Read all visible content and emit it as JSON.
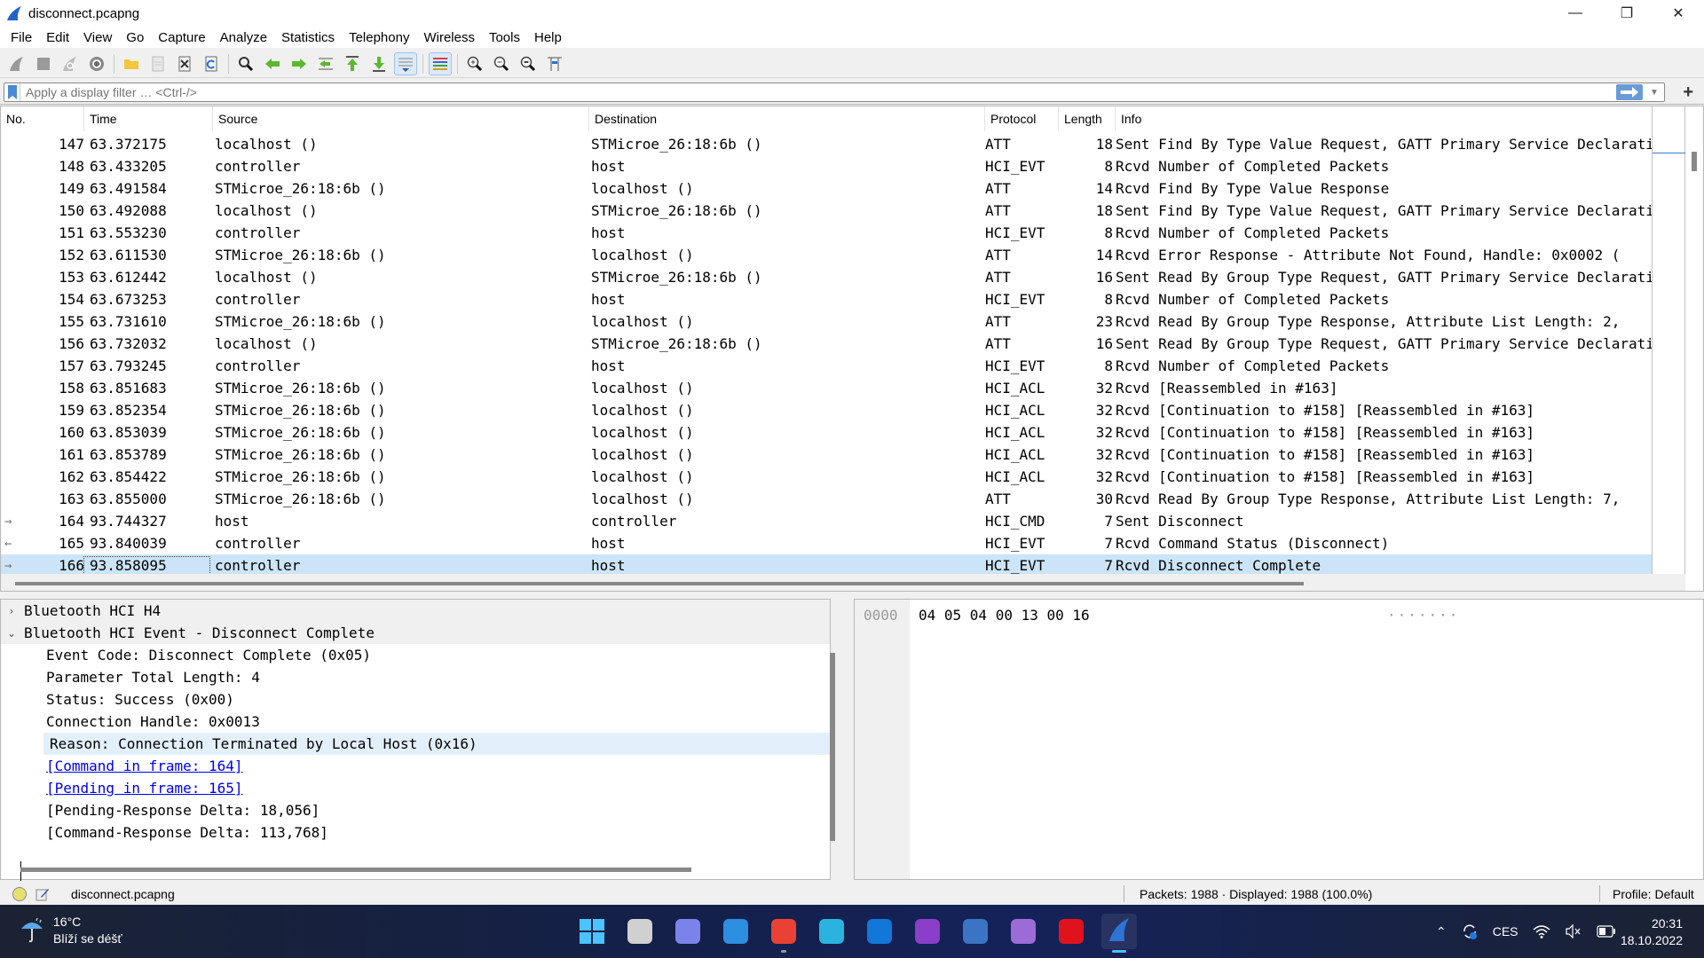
{
  "window": {
    "title": "disconnect.pcapng",
    "controls": [
      "minimize",
      "maximize",
      "close"
    ]
  },
  "menu": [
    "File",
    "Edit",
    "View",
    "Go",
    "Capture",
    "Analyze",
    "Statistics",
    "Telephony",
    "Wireless",
    "Tools",
    "Help"
  ],
  "toolbar": {
    "buttons": [
      {
        "name": "start-capture-icon",
        "active": false
      },
      {
        "name": "stop-capture-icon",
        "active": false
      },
      {
        "name": "restart-capture-icon",
        "active": false
      },
      {
        "name": "capture-options-icon",
        "active": false
      },
      {
        "name": "open-file-icon",
        "active": false
      },
      {
        "name": "save-file-icon",
        "active": false
      },
      {
        "name": "close-file-icon",
        "active": false
      },
      {
        "name": "reload-file-icon",
        "active": false
      },
      {
        "name": "find-packet-icon",
        "active": false
      },
      {
        "name": "go-back-icon",
        "active": false
      },
      {
        "name": "go-forward-icon",
        "active": false
      },
      {
        "name": "go-to-packet-icon",
        "active": false
      },
      {
        "name": "go-first-packet-icon",
        "active": false
      },
      {
        "name": "go-last-packet-icon",
        "active": false
      },
      {
        "name": "auto-scroll-icon",
        "active": true
      },
      {
        "name": "colorize-icon",
        "active": true
      },
      {
        "name": "zoom-in-icon",
        "active": false
      },
      {
        "name": "zoom-out-icon",
        "active": false
      },
      {
        "name": "normal-size-icon",
        "active": false
      },
      {
        "name": "resize-columns-icon",
        "active": false
      }
    ]
  },
  "filter": {
    "placeholder": "Apply a display filter … <Ctrl-/>",
    "value": ""
  },
  "packet_list": {
    "columns": [
      "No.",
      "Time",
      "Source",
      "Destination",
      "Protocol",
      "Length",
      "Info"
    ],
    "rows": [
      {
        "arrow": "",
        "no": "147",
        "time": "63.372175",
        "src": "localhost ()",
        "dst": "STMicroe_26:18:6b ()",
        "proto": "ATT",
        "len": "18",
        "info": "Sent Find By Type Value Request, GATT Primary Service Declaration"
      },
      {
        "arrow": "",
        "no": "148",
        "time": "63.433205",
        "src": "controller",
        "dst": "host",
        "proto": "HCI_EVT",
        "len": "8",
        "info": "Rcvd Number of Completed Packets"
      },
      {
        "arrow": "",
        "no": "149",
        "time": "63.491584",
        "src": "STMicroe_26:18:6b ()",
        "dst": "localhost ()",
        "proto": "ATT",
        "len": "14",
        "info": "Rcvd Find By Type Value Response"
      },
      {
        "arrow": "",
        "no": "150",
        "time": "63.492088",
        "src": "localhost ()",
        "dst": "STMicroe_26:18:6b ()",
        "proto": "ATT",
        "len": "18",
        "info": "Sent Find By Type Value Request, GATT Primary Service Declaration"
      },
      {
        "arrow": "",
        "no": "151",
        "time": "63.553230",
        "src": "controller",
        "dst": "host",
        "proto": "HCI_EVT",
        "len": "8",
        "info": "Rcvd Number of Completed Packets"
      },
      {
        "arrow": "",
        "no": "152",
        "time": "63.611530",
        "src": "STMicroe_26:18:6b ()",
        "dst": "localhost ()",
        "proto": "ATT",
        "len": "14",
        "info": "Rcvd Error Response - Attribute Not Found, Handle: 0x0002 ("
      },
      {
        "arrow": "",
        "no": "153",
        "time": "63.612442",
        "src": "localhost ()",
        "dst": "STMicroe_26:18:6b ()",
        "proto": "ATT",
        "len": "16",
        "info": "Sent Read By Group Type Request, GATT Primary Service Declaration"
      },
      {
        "arrow": "",
        "no": "154",
        "time": "63.673253",
        "src": "controller",
        "dst": "host",
        "proto": "HCI_EVT",
        "len": "8",
        "info": "Rcvd Number of Completed Packets"
      },
      {
        "arrow": "",
        "no": "155",
        "time": "63.731610",
        "src": "STMicroe_26:18:6b ()",
        "dst": "localhost ()",
        "proto": "ATT",
        "len": "23",
        "info": "Rcvd Read By Group Type Response, Attribute List Length: 2,"
      },
      {
        "arrow": "",
        "no": "156",
        "time": "63.732032",
        "src": "localhost ()",
        "dst": "STMicroe_26:18:6b ()",
        "proto": "ATT",
        "len": "16",
        "info": "Sent Read By Group Type Request, GATT Primary Service Declaration"
      },
      {
        "arrow": "",
        "no": "157",
        "time": "63.793245",
        "src": "controller",
        "dst": "host",
        "proto": "HCI_EVT",
        "len": "8",
        "info": "Rcvd Number of Completed Packets"
      },
      {
        "arrow": "",
        "no": "158",
        "time": "63.851683",
        "src": "STMicroe_26:18:6b ()",
        "dst": "localhost ()",
        "proto": "HCI_ACL",
        "len": "32",
        "info": "Rcvd  [Reassembled in #163]"
      },
      {
        "arrow": "",
        "no": "159",
        "time": "63.852354",
        "src": "STMicroe_26:18:6b ()",
        "dst": "localhost ()",
        "proto": "HCI_ACL",
        "len": "32",
        "info": "Rcvd  [Continuation to #158] [Reassembled in #163]"
      },
      {
        "arrow": "",
        "no": "160",
        "time": "63.853039",
        "src": "STMicroe_26:18:6b ()",
        "dst": "localhost ()",
        "proto": "HCI_ACL",
        "len": "32",
        "info": "Rcvd  [Continuation to #158] [Reassembled in #163]"
      },
      {
        "arrow": "",
        "no": "161",
        "time": "63.853789",
        "src": "STMicroe_26:18:6b ()",
        "dst": "localhost ()",
        "proto": "HCI_ACL",
        "len": "32",
        "info": "Rcvd  [Continuation to #158] [Reassembled in #163]"
      },
      {
        "arrow": "",
        "no": "162",
        "time": "63.854422",
        "src": "STMicroe_26:18:6b ()",
        "dst": "localhost ()",
        "proto": "HCI_ACL",
        "len": "32",
        "info": "Rcvd  [Continuation to #158] [Reassembled in #163]"
      },
      {
        "arrow": "",
        "no": "163",
        "time": "63.855000",
        "src": "STMicroe_26:18:6b ()",
        "dst": "localhost ()",
        "proto": "ATT",
        "len": "30",
        "info": "Rcvd Read By Group Type Response, Attribute List Length: 7,"
      },
      {
        "arrow": "→",
        "no": "164",
        "time": "93.744327",
        "src": "host",
        "dst": "controller",
        "proto": "HCI_CMD",
        "len": "7",
        "info": "Sent Disconnect"
      },
      {
        "arrow": "←",
        "no": "165",
        "time": "93.840039",
        "src": "controller",
        "dst": "host",
        "proto": "HCI_EVT",
        "len": "7",
        "info": "Rcvd Command Status (Disconnect)"
      },
      {
        "arrow": "→",
        "no": "166",
        "time": "93.858095",
        "src": "controller",
        "dst": "host",
        "proto": "HCI_EVT",
        "len": "7",
        "info": "Rcvd Disconnect Complete",
        "selected": true
      }
    ]
  },
  "details": {
    "tree": [
      {
        "label": "Bluetooth HCI H4",
        "expanded": false
      },
      {
        "label": "Bluetooth HCI Event - Disconnect Complete",
        "expanded": true,
        "children": [
          {
            "label": "Event Code: Disconnect Complete (0x05)"
          },
          {
            "label": "Parameter Total Length: 4"
          },
          {
            "label": "Status: Success (0x00)"
          },
          {
            "label": "Connection Handle: 0x0013"
          },
          {
            "label": "Reason: Connection Terminated by Local Host (0x16)",
            "highlighted": true
          },
          {
            "label": "[Command in frame: 164]",
            "link": true
          },
          {
            "label": "[Pending in frame: 165]",
            "link": true
          },
          {
            "label": "[Pending-Response Delta: 18,056]"
          },
          {
            "label": "[Command-Response Delta: 113,768]"
          }
        ]
      }
    ]
  },
  "bytes": {
    "offset": "0000",
    "hex": "04 05 04 00 13 00 16",
    "ascii": "·······"
  },
  "status": {
    "file": "disconnect.pcapng",
    "packets": "Packets: 1988 · Displayed: 1988 (100.0%)",
    "profile": "Profile: Default"
  },
  "taskbar": {
    "weather_temp": "16°C",
    "weather_desc": "Blíží se déšť",
    "apps": [
      {
        "name": "start-icon",
        "color": "#4cc2ff",
        "active": false,
        "running": false
      },
      {
        "name": "task-view-icon",
        "color": "#d0d0d0",
        "active": false,
        "running": false
      },
      {
        "name": "teams-chat-icon",
        "color": "#7b83eb",
        "active": false,
        "running": false
      },
      {
        "name": "vscode-icon",
        "color": "#2c8fe0",
        "active": false,
        "running": false
      },
      {
        "name": "chrome-icon",
        "color": "#e94235",
        "active": false,
        "running": true
      },
      {
        "name": "remote-desktop-icon",
        "color": "#2bb3e0",
        "active": false,
        "running": false
      },
      {
        "name": "outlook-icon",
        "color": "#1177d8",
        "active": false,
        "running": false
      },
      {
        "name": "onenote-icon",
        "color": "#8b3ec7",
        "active": false,
        "running": false
      },
      {
        "name": "powershell-icon",
        "color": "#3b74c2",
        "active": false,
        "running": false
      },
      {
        "name": "visual-studio-icon",
        "color": "#9b6bd6",
        "active": false,
        "running": false
      },
      {
        "name": "opera-icon",
        "color": "#e0131c",
        "active": false,
        "running": false
      },
      {
        "name": "wireshark-icon",
        "color": "#2e74d6",
        "active": true,
        "running": true
      }
    ],
    "language": "CES",
    "time": "20:31",
    "date": "18.10.2022"
  }
}
